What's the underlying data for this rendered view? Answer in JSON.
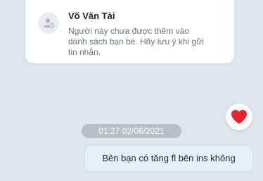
{
  "contact_card": {
    "name": "Võ Văn Tài",
    "note": "Người này chưa được thêm vào danh sách bạn bè. Hãy lưu ý khi gửi tin nhắn.",
    "avatar_icon": "user-unknown-icon"
  },
  "reaction": {
    "icon": "heart-icon",
    "color": "#e8232f"
  },
  "timestamp": "01:27 02/06/2021",
  "message": {
    "text": "Bên bạn có tăng fl bên ins không",
    "bubble_color": "#e4f1fd"
  }
}
